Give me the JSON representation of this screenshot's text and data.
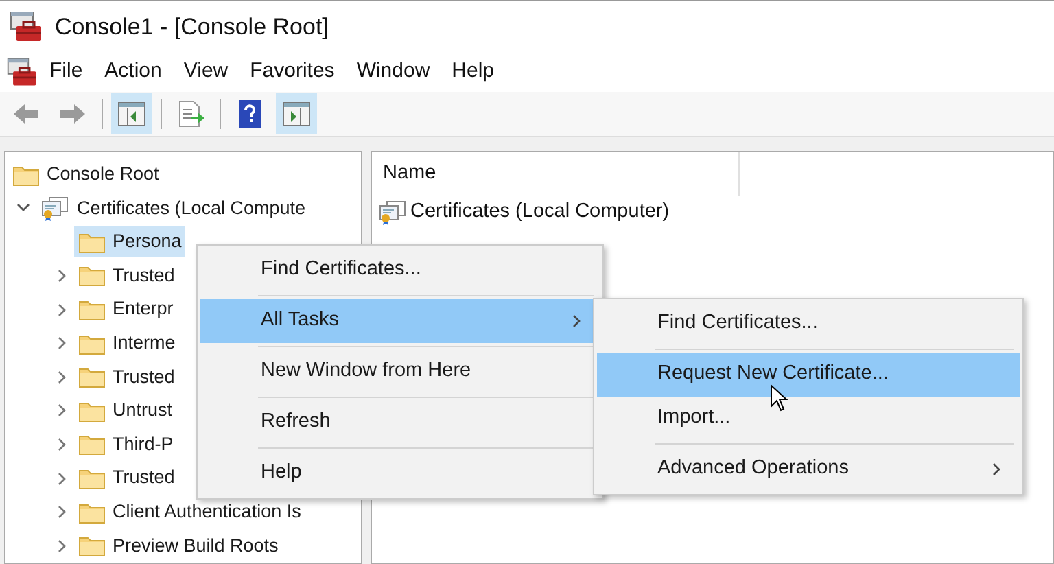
{
  "window": {
    "title": "Console1 - [Console Root]"
  },
  "menu_bar": [
    "File",
    "Action",
    "View",
    "Favorites",
    "Window",
    "Help"
  ],
  "toolbar": [
    {
      "kind": "back",
      "disabled": true,
      "pressed": false
    },
    {
      "kind": "forward",
      "disabled": true,
      "pressed": false
    },
    {
      "kind": "separator"
    },
    {
      "kind": "console-tree",
      "pressed": true
    },
    {
      "kind": "separator"
    },
    {
      "kind": "export",
      "pressed": false
    },
    {
      "kind": "separator"
    },
    {
      "kind": "help",
      "pressed": false
    },
    {
      "kind": "action-pane",
      "pressed": true
    }
  ],
  "tree": [
    {
      "label": "Console Root",
      "kind": "folder",
      "selected": false,
      "children": [
        {
          "label": "Certificates (Local Compute",
          "kind": "certificate",
          "expanded": true,
          "selected": false,
          "children": [
            {
              "label": "Persona",
              "kind": "folder",
              "selected": true
            },
            {
              "label": "Trusted",
              "kind": "folder",
              "expanded": false,
              "selected": false
            },
            {
              "label": "Enterpr",
              "kind": "folder",
              "expanded": false,
              "selected": false
            },
            {
              "label": "Interme",
              "kind": "folder",
              "expanded": false,
              "selected": false
            },
            {
              "label": "Trusted",
              "kind": "folder",
              "expanded": false,
              "selected": false
            },
            {
              "label": "Untrust",
              "kind": "folder",
              "expanded": false,
              "selected": false
            },
            {
              "label": "Third-P",
              "kind": "folder",
              "expanded": false,
              "selected": false
            },
            {
              "label": "Trusted",
              "kind": "folder",
              "expanded": false,
              "selected": false
            },
            {
              "label": "Client Authentication Is",
              "kind": "folder",
              "expanded": false,
              "selected": false
            },
            {
              "label": "Preview Build Roots",
              "kind": "folder",
              "expanded": false,
              "selected": false
            }
          ]
        }
      ]
    }
  ],
  "list": {
    "columns": [
      "Name"
    ],
    "rows": [
      {
        "name": "Certificates (Local Computer)"
      }
    ]
  },
  "context_menu": {
    "items": [
      {
        "label": "Find Certificates...",
        "selected": false,
        "submenu": false,
        "separator_after": true
      },
      {
        "label": "All Tasks",
        "selected": true,
        "submenu": true,
        "separator_after": true
      },
      {
        "label": "New Window from Here",
        "selected": false,
        "submenu": false,
        "separator_after": true
      },
      {
        "label": "Refresh",
        "selected": false,
        "submenu": false,
        "separator_after": true
      },
      {
        "label": "Help",
        "selected": false,
        "submenu": false,
        "separator_after": false
      }
    ]
  },
  "submenu": {
    "items": [
      {
        "label": "Find Certificates...",
        "selected": false,
        "submenu": false,
        "separator_after": true
      },
      {
        "label": "Request New Certificate...",
        "selected": true,
        "submenu": false,
        "separator_after": false
      },
      {
        "label": "Import...",
        "selected": false,
        "submenu": false,
        "separator_after": true
      },
      {
        "label": "Advanced Operations",
        "selected": false,
        "submenu": true,
        "separator_after": false
      }
    ]
  }
}
